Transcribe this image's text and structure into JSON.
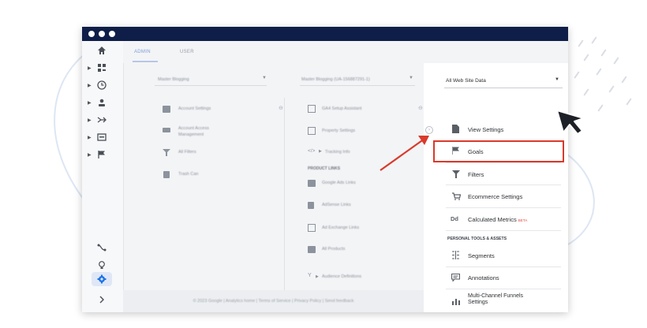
{
  "tabs": {
    "admin": "ADMIN",
    "user": "USER"
  },
  "account_selector": "Master Blogging",
  "property_selector": "Master Blogging (UA-156887291-1)",
  "view_selector": "All Web Site Data",
  "account_col": {
    "items": [
      "Account Settings",
      "Account Access Management",
      "All Filters",
      "Trash Can"
    ]
  },
  "property_col": {
    "items": [
      "GA4 Setup Assistant",
      "Property Settings",
      "Tracking Info"
    ],
    "product_links_header": "PRODUCT LINKS",
    "links": [
      "Google Ads Links",
      "AdSense Links",
      "Ad Exchange Links",
      "All Products",
      "Audience Definitions"
    ]
  },
  "view_col": {
    "view_settings": "View Settings",
    "goals": "Goals",
    "filters": "Filters",
    "ecommerce": "Ecommerce Settings",
    "calc_metrics": "Calculated Metrics",
    "calc_metrics_badge": "BETA",
    "calc_metrics_icon_text": "Dd",
    "personal_header": "PERSONAL TOOLS & ASSETS",
    "segments": "Segments",
    "annotations": "Annotations",
    "mcf_line1": "Multi-Channel Funnels",
    "mcf_line2": "Settings"
  },
  "footer": "© 2023 Google | Analytics home | Terms of Service | Privacy Policy |  Send feedback",
  "colors": {
    "titlebar": "#0f1e48",
    "highlight": "#d93a2b",
    "accent_blue": "#1a73e8",
    "beta": "#e8453c"
  }
}
